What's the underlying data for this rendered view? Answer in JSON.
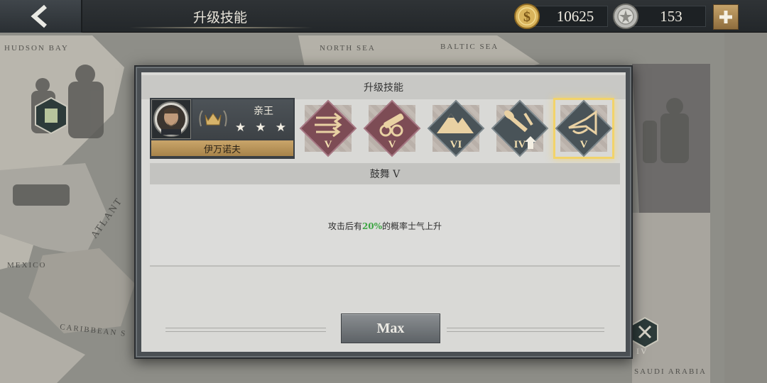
{
  "header": {
    "title": "升级技能",
    "gold": "10625",
    "medals": "153"
  },
  "map_labels": {
    "hudson_bay": "HUDSON BAY",
    "north_sea": "NORTH SEA",
    "baltic_sea": "BALTIC SEA",
    "atlantic": "ATLANT",
    "mexico": "MEXICO",
    "caribbean": "CARIBBEAN S",
    "saudi_arabia": "SAUDI ARABIA",
    "marker_level": "IV"
  },
  "modal": {
    "title": "升级技能",
    "general": {
      "rank": "亲王",
      "name": "伊万诺夫",
      "stars": 3
    },
    "skills": [
      {
        "icon": "arrows-icon",
        "level": "V",
        "color": "#7d4c55"
      },
      {
        "icon": "cannon-icon",
        "level": "V",
        "color": "#7d4c55"
      },
      {
        "icon": "mountain-icon",
        "level": "VI",
        "color": "#495358"
      },
      {
        "icon": "shovel-icon",
        "level": "IV",
        "color": "#495358"
      },
      {
        "icon": "bugle-icon",
        "level": "V",
        "color": "#495358"
      }
    ],
    "selected_skill": "鼓舞 V",
    "description_pre": "攻击后有",
    "description_value": "20%",
    "description_post": "的概率士气上升",
    "max_label": "Max"
  },
  "colors": {
    "highlight": "#3da543",
    "gold_accent": "#c9a56a",
    "selected_glow": "#f2d36a"
  }
}
